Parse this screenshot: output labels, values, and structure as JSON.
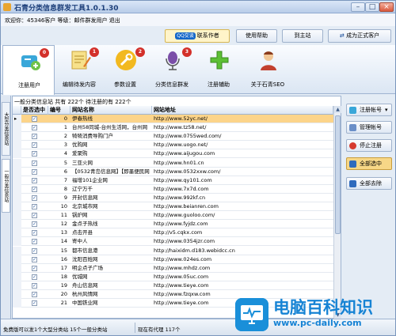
{
  "window": {
    "title": "石青分类信息群发工具1.0.1.30",
    "min": "–",
    "max": "□",
    "close": "×"
  },
  "info": {
    "text": "欢迎你：45346客户   等级：邮件群发用户   退出"
  },
  "top_buttons": {
    "qq_badge": "QQ交谈",
    "contact": "联系作者",
    "help": "使用帮助",
    "site": "到主站",
    "upgrade": "成为正式客户"
  },
  "tools": [
    {
      "label": "注册用户",
      "badge": "0"
    },
    {
      "label": "编辑待发内容",
      "badge": "1"
    },
    {
      "label": "参数设置",
      "badge": "2"
    },
    {
      "label": "分类信息群发",
      "badge": "3"
    },
    {
      "label": "注册辅助",
      "badge": ""
    },
    {
      "label": "关于石青SEO",
      "badge": ""
    }
  ],
  "side_tabs": {
    "tab1": "大型分类信息站",
    "tab2": "一般分类信息站"
  },
  "grid": {
    "caption": "一般分类信息站 共有 222个 待注册的有 222个",
    "headers": [
      "是否选中",
      "编号",
      "网站名称",
      "网站地址"
    ],
    "rows": [
      {
        "num": "0",
        "name": "伊春热线",
        "url": "http://www.52yc.net/"
      },
      {
        "num": "1",
        "name": "台州58同城-台州生活网，台州网",
        "url": "http://www.tz58.net/"
      },
      {
        "num": "2",
        "name": "犄犄消费导购门户",
        "url": "http://www.0755wed.com/"
      },
      {
        "num": "3",
        "name": "优购网",
        "url": "http://www.uogo.net/"
      },
      {
        "num": "4",
        "name": "爱聚购",
        "url": "http://www.aijugou.com"
      },
      {
        "num": "5",
        "name": "三亚火网",
        "url": "http://www.hn01.cn"
      },
      {
        "num": "6",
        "name": "【0532青岛信息网】【即墨便民网",
        "url": "http://www.0532xxw.com/"
      },
      {
        "num": "7",
        "name": "福增101企业网",
        "url": "http://www.qy101.com"
      },
      {
        "num": "8",
        "name": "辽宁万千",
        "url": "http://www.7x7d.com"
      },
      {
        "num": "9",
        "name": "开封信息网",
        "url": "http://www.992kf.cn"
      },
      {
        "num": "10",
        "name": "北京城市网",
        "url": "http://www.beianren.com"
      },
      {
        "num": "11",
        "name": "锅炉网",
        "url": "http://www.guoloo.com/"
      },
      {
        "num": "12",
        "name": "金点子热线",
        "url": "http://www.fyjdz.com"
      },
      {
        "num": "13",
        "name": "点击开县",
        "url": "http://v5.cqkx.com"
      },
      {
        "num": "14",
        "name": "寄中人",
        "url": "http://www.0354jzr.com"
      },
      {
        "num": "15",
        "name": "都市信息港",
        "url": "http://haixidm.d183.webidcc.cn"
      },
      {
        "num": "16",
        "name": "沈阳百姓网",
        "url": "http://www.024es.com"
      },
      {
        "num": "17",
        "name": "明企点子广场",
        "url": "http://www.mhdz.com"
      },
      {
        "num": "18",
        "name": "优城网",
        "url": "http://www.05uc.com"
      },
      {
        "num": "19",
        "name": "舟山信息网",
        "url": "http://www.tieye.com"
      },
      {
        "num": "20",
        "name": "杭州风情网",
        "url": "http://www.fzqxw.com"
      },
      {
        "num": "21",
        "name": "中国铁业网",
        "url": "http://www.tieye.com"
      }
    ],
    "selected_row": 0,
    "check_mark": "✓"
  },
  "right_buttons": {
    "account": "注册帐号",
    "manage": "管理帐号",
    "stop": "停止注册",
    "select_all": "全部选中",
    "clear_all": "全部去除"
  },
  "status": {
    "free": "免费版可以发1个大型分类站 15个一般分类站",
    "agents": "现在有代理 117个"
  },
  "watermark": {
    "title": "电脑百科知识",
    "url": "www.pc-daily.com"
  },
  "colors": {
    "accent": "#1683d4",
    "selection": "#fcd48a",
    "badge": "#d3302a"
  }
}
